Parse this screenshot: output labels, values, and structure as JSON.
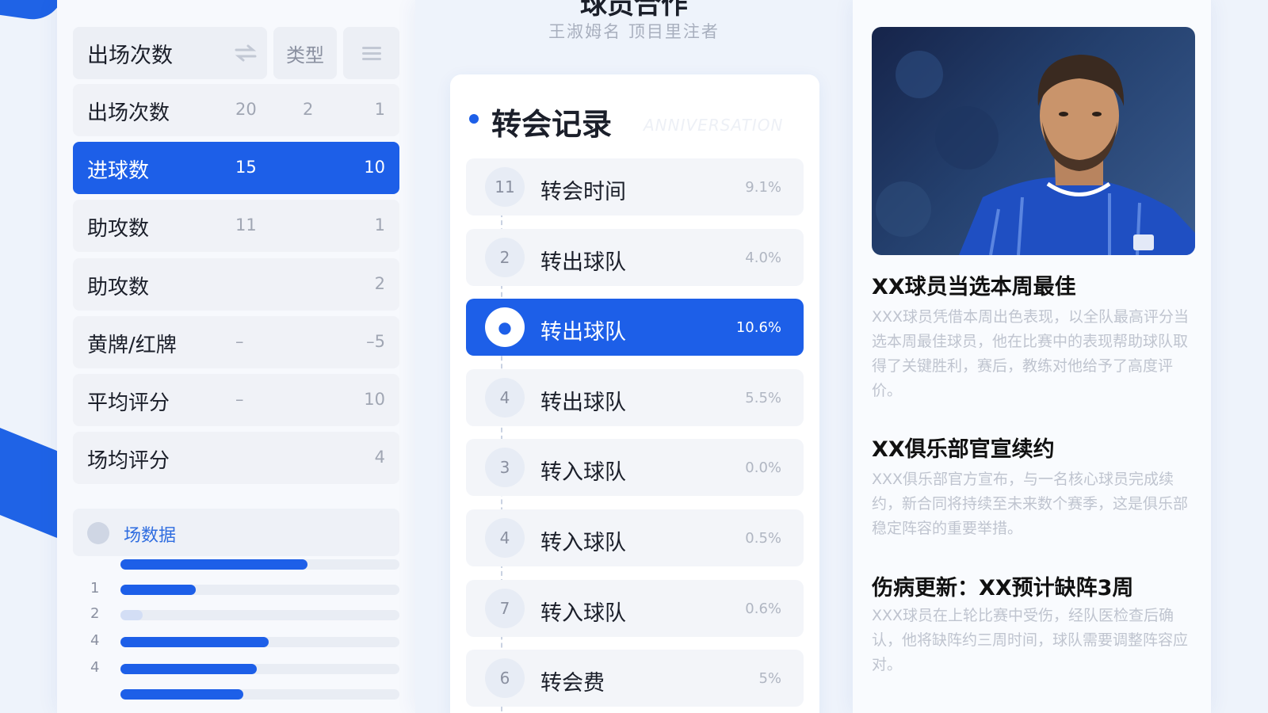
{
  "left": {
    "header": {
      "label": "出场次数",
      "tab": "类型"
    },
    "rows": [
      {
        "label": "出场次数",
        "v1": "20",
        "v2": "2",
        "v3": "1"
      },
      {
        "label": "进球数",
        "v1": "15",
        "v2": "",
        "v3": "10"
      },
      {
        "label": "助攻数",
        "v1": "11",
        "v2": "",
        "v3": "1"
      },
      {
        "label": "助攻数",
        "v1": "",
        "v2": "",
        "v3": "2"
      },
      {
        "label": "黄牌/红牌",
        "v1": "–",
        "v2": "",
        "v3": "–5"
      },
      {
        "label": "平均评分",
        "v1": "–",
        "v2": "",
        "v3": "10"
      },
      {
        "label": "场均评分",
        "v1": "",
        "v2": "",
        "v3": "4"
      }
    ],
    "matches_label": "场数据",
    "bars": [
      {
        "num": "",
        "fill": 0.67
      },
      {
        "num": "1",
        "fill": 0.27
      },
      {
        "num": "2",
        "fill": 0.08
      },
      {
        "num": "4",
        "fill": 0.53
      },
      {
        "num": "4",
        "fill": 0.49
      },
      {
        "num": "",
        "fill": 0.44
      }
    ]
  },
  "middle": {
    "title": "球员合作",
    "subtitle": "王淑姆名 顶目里注者",
    "card_title": "转会记录",
    "card_ghost": "ANNIVERSATION",
    "rows": [
      {
        "num": "11",
        "label": "转会时间",
        "value": "9.1%"
      },
      {
        "num": "2",
        "label": "转出球队",
        "value": "4.0%"
      },
      {
        "num": "●",
        "label": "转出球队",
        "value": "10.6%"
      },
      {
        "num": "4",
        "label": "转出球队",
        "value": "5.5%"
      },
      {
        "num": "3",
        "label": "转入球队",
        "value": "0.0%"
      },
      {
        "num": "4",
        "label": "转入球队",
        "value": "0.5%"
      },
      {
        "num": "7",
        "label": "转入球队",
        "value": "0.6%"
      },
      {
        "num": "6",
        "label": "转会费",
        "value": "5%"
      }
    ]
  },
  "right": {
    "news": [
      {
        "title": "XX球员当选本周最佳",
        "body": "XXX球员凭借本周出色表现，以全队最高评分当选本周最佳球员，他在比赛中的表现帮助球队取得了关键胜利，赛后，教练对他给予了高度评价。"
      },
      {
        "title": "XX俱乐部官宣续约",
        "body": "XXX俱乐部官方宣布，与一名核心球员完成续约，新合同将持续至未来数个赛季，这是俱乐部稳定阵容的重要举措。"
      },
      {
        "title": "伤病更新：XX预计缺阵3周",
        "body": "XXX球员在上轮比赛中受伤，经队医检查后确认，他将缺阵约三周时间，球队需要调整阵容应对。"
      }
    ]
  }
}
